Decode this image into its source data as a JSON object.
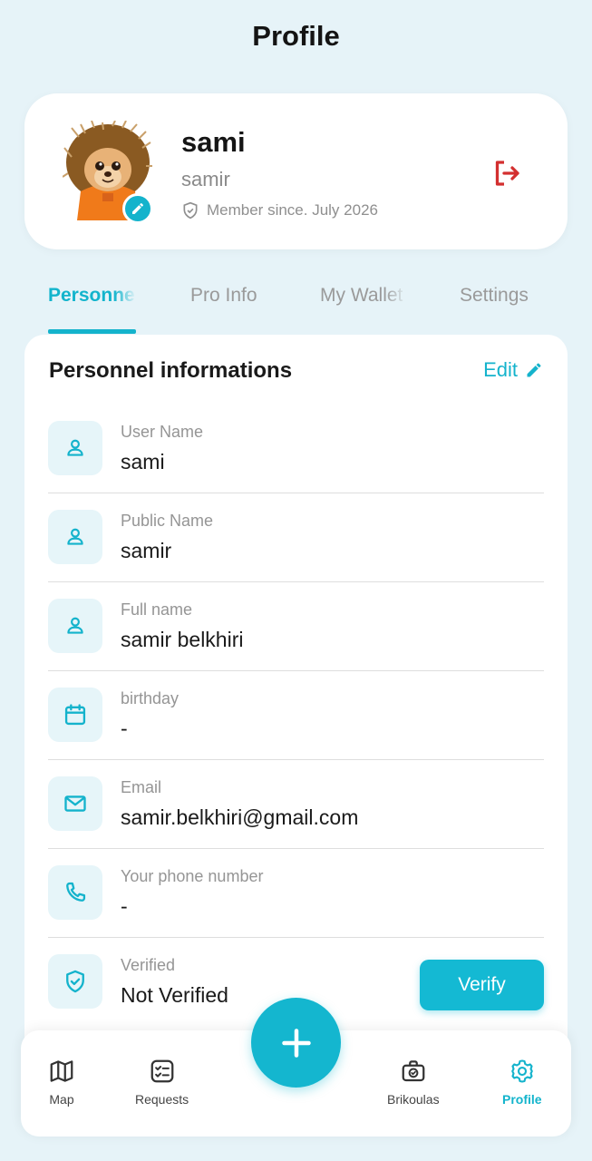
{
  "header": {
    "title": "Profile"
  },
  "profile": {
    "name": "sami",
    "handle": "samir",
    "member_since": "Member since. July 2026"
  },
  "tabs": [
    {
      "label": "Personnel"
    },
    {
      "label": "Pro Info"
    },
    {
      "label": "My Wallet"
    },
    {
      "label": "Settings"
    }
  ],
  "section": {
    "title": "Personnel informations",
    "edit_label": "Edit"
  },
  "fields": [
    {
      "label": "User Name",
      "value": "sami",
      "icon": "user-icon"
    },
    {
      "label": "Public Name",
      "value": "samir",
      "icon": "user-icon"
    },
    {
      "label": "Full name",
      "value": "samir belkhiri",
      "icon": "user-icon"
    },
    {
      "label": "birthday",
      "value": "-",
      "icon": "calendar-icon"
    },
    {
      "label": "Email",
      "value": "samir.belkhiri@gmail.com",
      "icon": "mail-icon"
    },
    {
      "label": "Your phone number",
      "value": "-",
      "icon": "phone-icon"
    },
    {
      "label": "Verified",
      "value": "Not Verified",
      "icon": "shield-check-icon"
    }
  ],
  "verify_button": {
    "label": "Verify"
  },
  "nav": {
    "items": [
      {
        "label": "Map",
        "icon": "map-icon"
      },
      {
        "label": "Requests",
        "icon": "checklist-icon"
      },
      {
        "label": "Brikoulas",
        "icon": "toolbox-icon"
      },
      {
        "label": "Profile",
        "icon": "gear-icon"
      }
    ],
    "fab_icon": "plus-icon"
  },
  "colors": {
    "accent": "#14b3cc",
    "background": "#e6f3f8",
    "logout": "#d32f2f"
  }
}
